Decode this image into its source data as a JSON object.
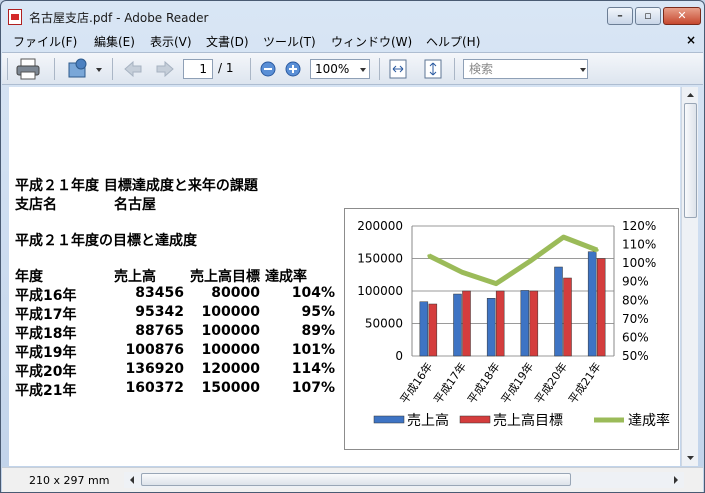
{
  "window": {
    "title": "名古屋支店.pdf - Adobe Reader",
    "min": "–",
    "max": "▫",
    "close": "✕"
  },
  "menu": [
    {
      "label": "ファイル(F)"
    },
    {
      "label": "編集(E)"
    },
    {
      "label": "表示(V)"
    },
    {
      "label": "文書(D)"
    },
    {
      "label": "ツール(T)"
    },
    {
      "label": "ウィンドウ(W)"
    },
    {
      "label": "ヘルプ(H)"
    }
  ],
  "menu_close": "×",
  "toolbar": {
    "page_current": "1",
    "page_total": "/ 1",
    "zoom": "100%",
    "search_placeholder": "検索"
  },
  "document": {
    "heading": "平成２１年度 目標達成度と来年の課題",
    "branch_label": "支店名",
    "branch_value": "名古屋",
    "section_title": "平成２１年度の目標と達成度",
    "table": {
      "headers": [
        "年度",
        "売上高",
        "売上高目標",
        "達成率"
      ],
      "rows": [
        [
          "平成16年",
          "83456",
          "80000",
          "104%"
        ],
        [
          "平成17年",
          "95342",
          "100000",
          "95%"
        ],
        [
          "平成18年",
          "88765",
          "100000",
          "89%"
        ],
        [
          "平成19年",
          "100876",
          "100000",
          "101%"
        ],
        [
          "平成20年",
          "136920",
          "120000",
          "114%"
        ],
        [
          "平成21年",
          "160372",
          "150000",
          "107%"
        ]
      ]
    }
  },
  "chart_data": {
    "type": "bar",
    "categories": [
      "平成16年",
      "平成17年",
      "平成18年",
      "平成19年",
      "平成20年",
      "平成21年"
    ],
    "series": [
      {
        "name": "売上高",
        "type": "bar",
        "values": [
          83456,
          95342,
          88765,
          100876,
          136920,
          160372
        ],
        "color": "#3e74c4"
      },
      {
        "name": "売上高目標",
        "type": "bar",
        "values": [
          80000,
          100000,
          100000,
          100000,
          120000,
          150000
        ],
        "color": "#d43d3d"
      },
      {
        "name": "達成率",
        "type": "line",
        "axis": "right",
        "values": [
          1.04,
          0.95,
          0.89,
          1.01,
          1.14,
          1.07
        ],
        "color": "#9bbb59"
      }
    ],
    "y_left": {
      "min": 0,
      "max": 200000,
      "ticks": [
        "0",
        "50000",
        "100000",
        "150000",
        "200000"
      ]
    },
    "y_right": {
      "min": 0.5,
      "max": 1.2,
      "ticks": [
        "50%",
        "60%",
        "70%",
        "80%",
        "90%",
        "100%",
        "110%",
        "120%"
      ]
    },
    "legend": "bottom"
  },
  "status": {
    "page_size": "210 x 297 mm"
  }
}
